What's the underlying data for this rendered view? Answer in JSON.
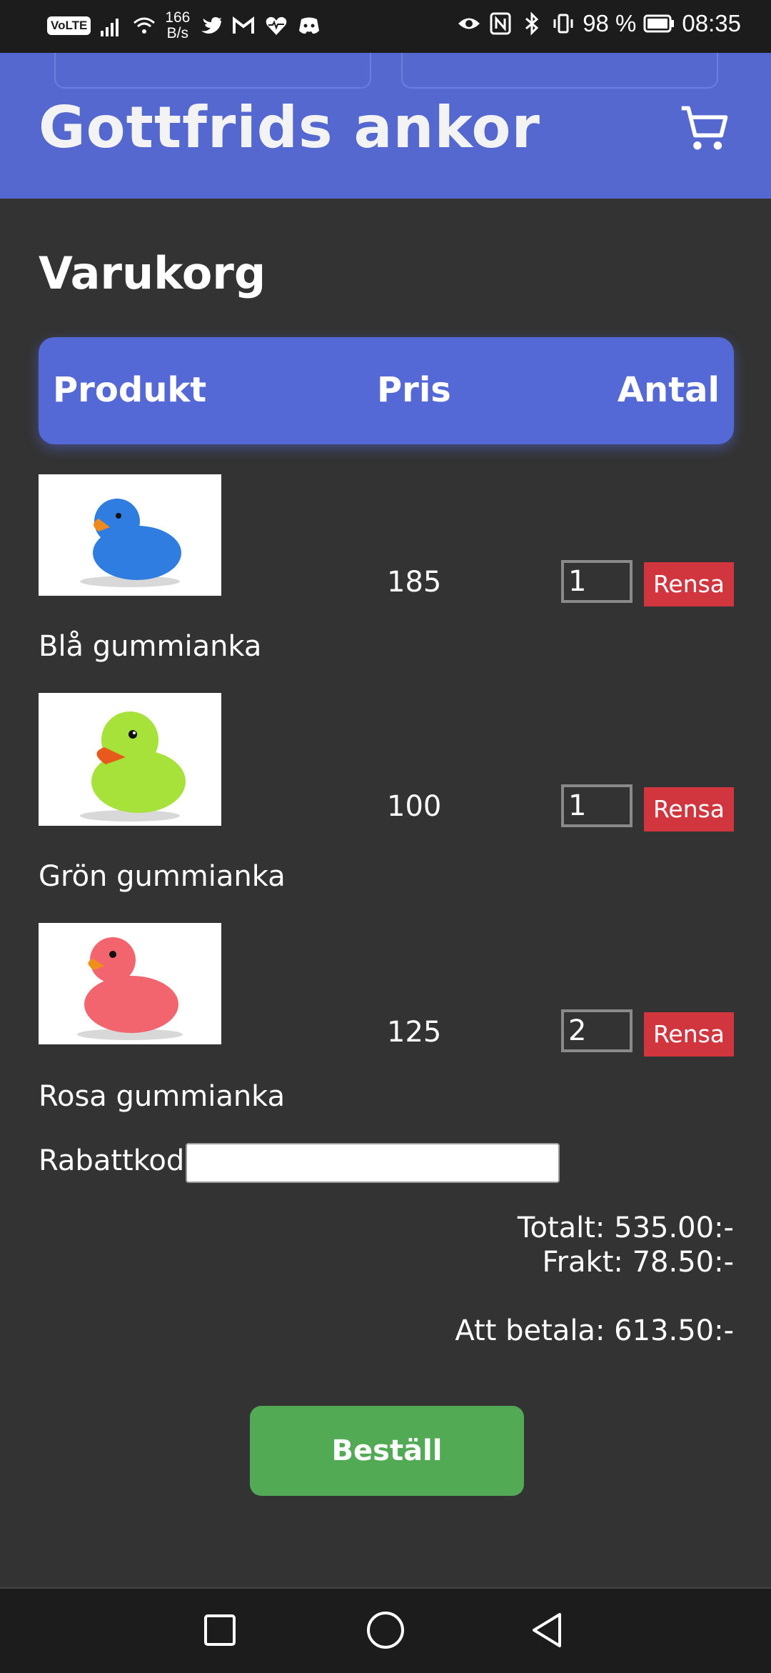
{
  "status_bar": {
    "network_label": "VoLTE",
    "speed": "166",
    "speed_unit": "B/s",
    "battery": "98 %",
    "time": "08:35"
  },
  "app_bar": {
    "title": "Gottfrids ankor",
    "cart_icon": "shopping-cart-icon"
  },
  "page": {
    "title": "Varukorg"
  },
  "table": {
    "headers": [
      "Produkt",
      "Pris",
      "Antal"
    ]
  },
  "cart_items": [
    {
      "name": "Blå gummianka",
      "price": "185",
      "quantity": "1",
      "remove_label": "Rensa",
      "duck_color": "#2f7de0"
    },
    {
      "name": "Grön gummianka",
      "price": "100",
      "quantity": "1",
      "remove_label": "Rensa",
      "duck_color": "#a6e23a"
    },
    {
      "name": "Rosa gummianka",
      "price": "125",
      "quantity": "2",
      "remove_label": "Rensa",
      "duck_color": "#f2646e"
    }
  ],
  "discount": {
    "label": "Rabattkod",
    "value": ""
  },
  "summary": {
    "total": "Totalt: 535.00:-",
    "shipping": "Frakt: 78.50:-",
    "to_pay": "Att betala: 613.50:-"
  },
  "order_button": {
    "label": "Beställ"
  },
  "colors": {
    "accent": "#5468d6",
    "background": "#333333",
    "danger": "#d1363f",
    "success": "#53aa55"
  }
}
